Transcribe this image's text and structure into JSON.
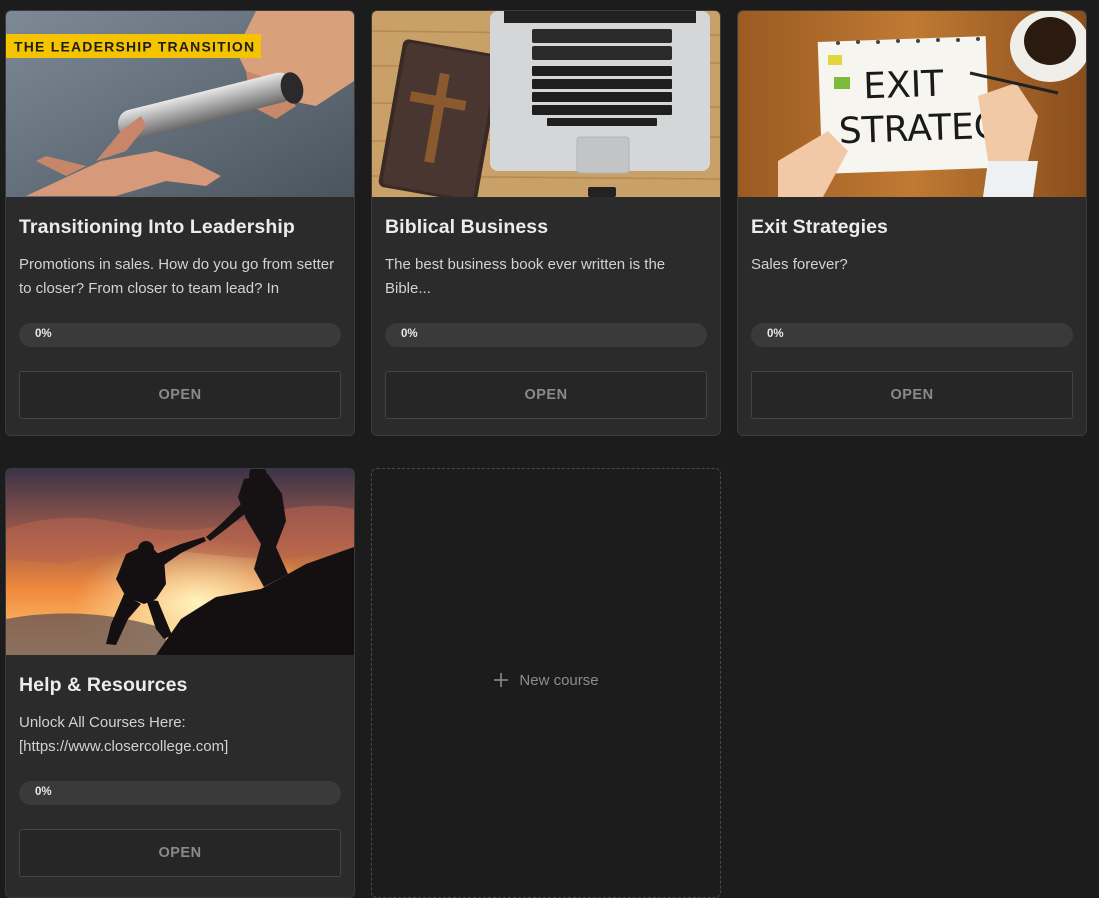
{
  "courses": [
    {
      "title": "Transitioning Into Leadership",
      "description": "Promotions in sales. How do you go from setter to closer? From closer to team lead? In",
      "progress_label": "0%",
      "progress_fraction": 0,
      "button_label": "OPEN",
      "image_caption": "THE LEADERSHIP TRANSITION",
      "image_icon": "baton-handoff-image"
    },
    {
      "title": "Biblical Business",
      "description": "The best business book ever written is the Bible...",
      "progress_label": "0%",
      "progress_fraction": 0,
      "button_label": "OPEN",
      "image_icon": "bible-and-laptop-image"
    },
    {
      "title": "Exit Strategies",
      "description": "Sales forever?",
      "progress_label": "0%",
      "progress_fraction": 0,
      "button_label": "OPEN",
      "image_caption_line1": "EXIT",
      "image_caption_line2": "STRATEGY",
      "image_icon": "exit-strategy-notebook-image"
    },
    {
      "title": "Help & Resources",
      "description": "Unlock All Courses Here: [https://www.closercollege.com]",
      "progress_label": "0%",
      "progress_fraction": 0,
      "button_label": "OPEN",
      "image_icon": "sunset-climbers-image"
    }
  ],
  "new_course": {
    "label": "New course",
    "icon": "plus-icon"
  },
  "colors": {
    "background": "#1c1c1c",
    "card": "#2b2b2b",
    "accent_yellow": "#f5c400"
  }
}
